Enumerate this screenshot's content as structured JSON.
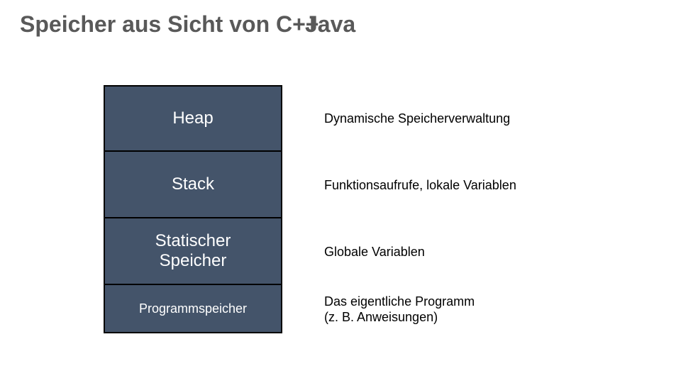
{
  "title": {
    "prefix": "Speicher aus Sicht von ",
    "tech1": "C++",
    "tech2": "Java"
  },
  "rows": {
    "r1": {
      "name": "Heap",
      "desc": "Dynamische Speicherverwaltung"
    },
    "r2": {
      "name": "Stack",
      "desc": "Funktionsaufrufe, lokale Variablen"
    },
    "r3": {
      "name": "Statischer\nSpeicher",
      "desc": "Globale Variablen"
    },
    "r4": {
      "name": "Programmspeicher",
      "desc": "Das eigentliche Programm\n(z. B. Anweisungen)"
    }
  }
}
